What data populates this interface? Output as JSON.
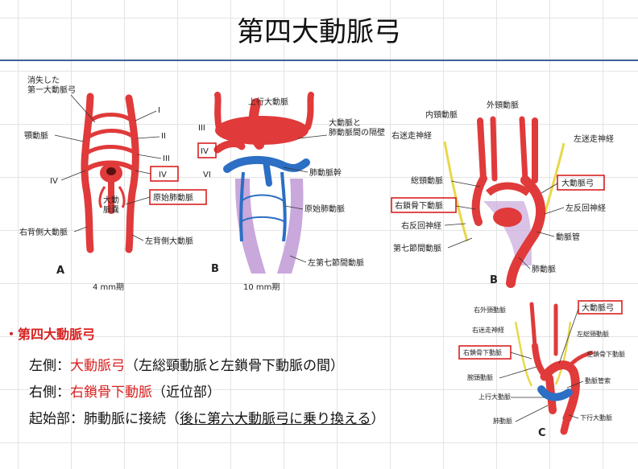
{
  "title": "第四大動脈弓",
  "colors": {
    "artery": "#e03a3a",
    "artery_dark": "#b32020",
    "vein_blue": "#2c6fc4",
    "lilac": "#c9a8dc",
    "nerve": "#e8d84a",
    "highlight_box": "#d92020",
    "rule": "#3f5f99"
  },
  "panelA": {
    "labels": {
      "vanished": "消失した\n第一大動脈弓",
      "carotid": "顎動脈",
      "I": "I",
      "II": "II",
      "III": "III",
      "IV_left": "IV",
      "IV_box": "IV",
      "aortic_sac": "大動\n脈嚢",
      "primitive_pulm": "原始肺動脈",
      "right_dorsal": "右背側大動脈",
      "left_dorsal": "左背側大動脈",
      "letter": "A",
      "stage": "4 mm期"
    }
  },
  "panelB": {
    "labels": {
      "ascending": "上行大動脈",
      "III": "III",
      "IV_box": "IV",
      "VI": "VI",
      "septum": "大動脈と\n肺動脈間の隔壁",
      "pulm_trunk": "肺動脈幹",
      "primitive_pulm": "原始肺動脈",
      "seventh": "左第七節間動脈",
      "letter": "B",
      "stage": "10 mm期"
    }
  },
  "panelB2": {
    "labels": {
      "internal_carotid": "内頸動脈",
      "external_carotid": "外頸動脈",
      "right_vagus": "右迷走神経",
      "left_vagus": "左迷走神経",
      "common_carotid": "総頸動脈",
      "aortic_arch_box": "大動脈弓",
      "right_subclavian_box": "右鎖骨下動脈",
      "left_recurrent": "左反回神経",
      "right_recurrent": "右反回神経",
      "ductus": "動脈管",
      "seventh_inter": "第七節間動脈",
      "pulmonary": "肺動脈",
      "letter": "B"
    }
  },
  "panelC": {
    "labels": {
      "right_external_carotid": "右外頸動脈",
      "aortic_arch_box": "大動脈弓",
      "right_vagus": "右迷走神経",
      "left_common_carotid": "左総頸動脈",
      "right_subclavian_box": "右鎖骨下動脈",
      "left_subclavian": "左鎖骨下動脈",
      "brachiocephalic": "腕頭動脈",
      "ligamentum": "動脈管索",
      "ascending": "上行大動脈",
      "pulmonary": "肺動脈",
      "descending": "下行大動脈",
      "letter": "C"
    }
  },
  "bullets": {
    "heading": "・第四大動脈弓",
    "left_prefix": "左側：",
    "left_red": "大動脈弓",
    "left_rest": "（左総頸動脈と左鎖骨下動脈の間）",
    "right_prefix": "右側：",
    "right_red": "右鎖骨下動脈",
    "right_rest": "（近位部）",
    "origin_prefix": "起始部：肺動脈に接続（",
    "origin_ul": "後に第六大動脈弓に乗り換える",
    "origin_suffix": "）"
  }
}
